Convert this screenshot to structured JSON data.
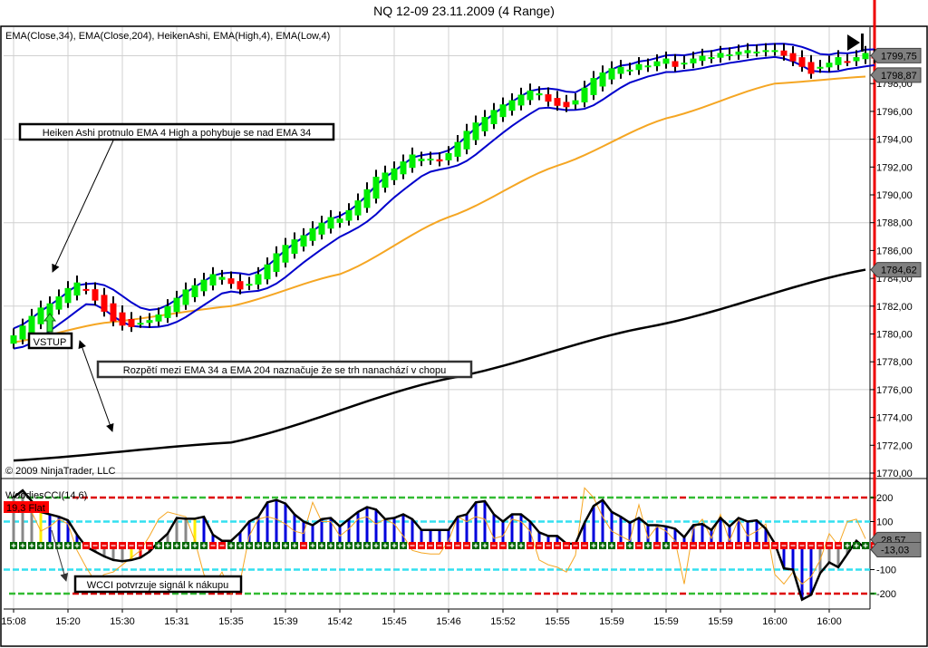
{
  "window_title": "NQ 12-09  23.11.2009 (4 Range)",
  "price_panel": {
    "indicator_label": "EMA(Close,34), EMA(Close,204), HeikenAshi, EMA(High,4), EMA(Low,4)",
    "copyright": "© 2009 NinjaTrader, LLC",
    "tags": [
      {
        "text": "1799,75",
        "value": 1799.75
      },
      {
        "text": "1798,87",
        "value": 1798.87
      },
      {
        "text": "1784,62",
        "value": 1784.62
      }
    ],
    "annotations": {
      "ha_note": "Heiken Ashi protnulo EMA 4 High a pohybuje se nad EMA 34",
      "entry": "VSTUP",
      "spread_note": "Rozpětí mezi EMA 34 a EMA 204 naznačuje že se trh nanachází v chopu"
    },
    "scroll_end_icon": "play-to-end-icon"
  },
  "cci_panel": {
    "label": "WoodiesCCI(14,6)",
    "badge": "19,3 Flat",
    "badge_color": "#ff0000",
    "note": "WCCI potvrzuje signál k nákupu",
    "tags": [
      {
        "text": "28,57",
        "value": 28.57
      },
      {
        "text": "-13,03",
        "value": -13.03
      }
    ]
  },
  "chart_data": [
    {
      "type": "candlestick",
      "title": "",
      "ylim": [
        1770,
        1801
      ],
      "y_ticks": [
        "1770,00",
        "1772,00",
        "1774,00",
        "1776,00",
        "1778,00",
        "1780,00",
        "1782,00",
        "1784,00",
        "1786,00",
        "1788,00",
        "1790,00",
        "1792,00",
        "1794,00",
        "1796,00",
        "1798,00"
      ],
      "x_ticks": [
        "15:08",
        "15:20",
        "15:30",
        "15:31",
        "15:35",
        "15:39",
        "15:42",
        "15:45",
        "15:46",
        "15:52",
        "15:55",
        "15:59",
        "15:59",
        "15:59",
        "16:00",
        "16:00"
      ],
      "grid": true,
      "colors": {
        "up": "#00ee00",
        "down": "#ff0000",
        "ema_band": "#0000cc",
        "ema34": "#f5a623",
        "ema204": "#000000"
      },
      "heiken_ashi_close": [
        1779.9,
        1780.6,
        1781.3,
        1781.9,
        1782.2,
        1782.7,
        1783.3,
        1783.7,
        1783.2,
        1782.4,
        1781.6,
        1780.9,
        1780.6,
        1780.5,
        1780.8,
        1781.0,
        1781.4,
        1782.0,
        1782.6,
        1783.2,
        1783.5,
        1783.9,
        1784.3,
        1784.1,
        1783.6,
        1783.2,
        1783.6,
        1784.3,
        1785.0,
        1785.8,
        1786.4,
        1786.8,
        1787.1,
        1787.6,
        1788.0,
        1788.4,
        1788.3,
        1788.9,
        1789.6,
        1790.4,
        1791.3,
        1791.6,
        1791.9,
        1792.4,
        1792.9,
        1792.6,
        1792.6,
        1792.4,
        1793.0,
        1793.8,
        1794.6,
        1795.2,
        1795.6,
        1796.1,
        1796.5,
        1796.8,
        1797.2,
        1797.5,
        1797.3,
        1796.7,
        1796.4,
        1796.3,
        1796.8,
        1797.7,
        1798.4,
        1798.8,
        1799.1,
        1799.2,
        1799.0,
        1799.4,
        1799.3,
        1799.6,
        1799.8,
        1799.2,
        1799.5,
        1799.8,
        1800.0,
        1799.9,
        1800.2,
        1800.1,
        1800.3,
        1800.4,
        1800.3,
        1800.4,
        1800.4,
        1800.0,
        1799.6,
        1799.2,
        1798.7,
        1799.2,
        1799.5,
        1799.9,
        1799.6,
        1799.9,
        1800.2,
        1799.8
      ],
      "ema34_points": [
        [
          0,
          1779.4
        ],
        [
          10,
          1780.8
        ],
        [
          24,
          1782.0
        ],
        [
          36,
          1784.3
        ],
        [
          48,
          1788.4
        ],
        [
          60,
          1792.1
        ],
        [
          72,
          1795.5
        ],
        [
          84,
          1798.0
        ],
        [
          94,
          1798.5
        ]
      ],
      "ema204_points": [
        [
          0,
          1770.9
        ],
        [
          24,
          1772.2
        ],
        [
          48,
          1776.8
        ],
        [
          70,
          1780.5
        ],
        [
          94,
          1784.62
        ]
      ]
    },
    {
      "type": "line+histogram",
      "title": "WoodiesCCI(14,6)",
      "ylim": [
        -250,
        250
      ],
      "y_ticks": [
        200,
        100,
        -100,
        -200
      ],
      "levels": [
        200,
        100,
        -100,
        -200
      ],
      "colors": {
        "cci": "#000000",
        "turbo": "#f5a623",
        "level100": "#33e0f0",
        "level200": "#33bb33",
        "level200_alert": "#dd0000"
      },
      "cci14": [
        200,
        230,
        185,
        140,
        130,
        120,
        105,
        45,
        -5,
        -25,
        -45,
        -60,
        -65,
        -60,
        -50,
        -25,
        15,
        50,
        115,
        112,
        112,
        120,
        45,
        20,
        20,
        55,
        100,
        120,
        180,
        190,
        175,
        130,
        100,
        85,
        110,
        115,
        80,
        110,
        140,
        160,
        150,
        110,
        115,
        130,
        110,
        65,
        65,
        65,
        65,
        120,
        130,
        180,
        185,
        130,
        100,
        130,
        130,
        100,
        55,
        40,
        40,
        8,
        8,
        95,
        165,
        190,
        140,
        120,
        95,
        115,
        85,
        85,
        80,
        70,
        35,
        85,
        90,
        65,
        115,
        80,
        115,
        100,
        105,
        70,
        8,
        -95,
        -100,
        -225,
        -205,
        -115,
        -70,
        -90,
        -35,
        20,
        -13.03
      ],
      "cci6": [
        150,
        170,
        140,
        60,
        80,
        110,
        90,
        -20,
        -90,
        -150,
        -120,
        -110,
        -80,
        -50,
        -20,
        40,
        110,
        140,
        130,
        120,
        20,
        -120,
        -170,
        -110,
        -200,
        -150,
        40,
        110,
        120,
        110,
        90,
        60,
        50,
        180,
        100,
        100,
        40,
        70,
        110,
        120,
        90,
        110,
        90,
        40,
        -20,
        -30,
        -35,
        -35,
        20,
        120,
        100,
        120,
        110,
        30,
        40,
        110,
        100,
        60,
        -60,
        -80,
        -90,
        -110,
        -40,
        240,
        200,
        120,
        60,
        40,
        20,
        170,
        30,
        80,
        60,
        20,
        -160,
        70,
        110,
        30,
        130,
        20,
        110,
        40,
        60,
        90,
        -120,
        -160,
        -110,
        -160,
        -130,
        -60,
        50,
        0,
        100,
        110,
        28.57
      ],
      "trend_markers": "++++++++--------++++++--++++++++-+++++++++++-------++--++-------+++-+-+-+-------------------+++",
      "histogram_colors": "gggybbbbgggggyrrggggybbbbbbbbbbbbbbbbbbbbbbbbbbbbbbbbbbbbbbbbbbbbbbbbbbbbbbbbbbbbbbbbbbbbgggggyrrgg"
    }
  ]
}
